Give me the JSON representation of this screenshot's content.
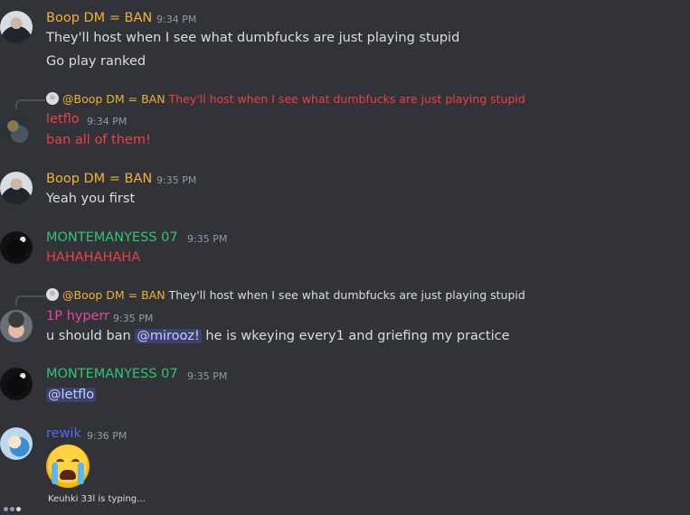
{
  "colors": {
    "boop": "#f0b232",
    "letflo": "#f23f43",
    "monte": "#2dc770",
    "hyperr": "#eb459f",
    "rewik": "#5865f2"
  },
  "messages": [
    {
      "author": "Boop DM = BAN",
      "time": "9:34 PM",
      "lines": [
        "They'll host when I see what dumbfucks are just playing stupid",
        "Go play ranked"
      ]
    },
    {
      "reply": {
        "mention": "@Boop DM = BAN",
        "text": "They'll host when I see what dumbfucks are just playing stupid"
      },
      "author": "letflo",
      "time": "9:34 PM",
      "lines": [
        "ban all of them!"
      ]
    },
    {
      "author": "Boop DM = BAN",
      "time": "9:35 PM",
      "lines": [
        "Yeah you first"
      ]
    },
    {
      "author": "MONTEMANYESS 07",
      "time": "9:35 PM",
      "lines": [
        "HAHAHAHAHA"
      ]
    },
    {
      "reply": {
        "mention": "@Boop DM = BAN",
        "text": "They'll host when I see what dumbfucks are just playing stupid"
      },
      "author": "1P hyperr",
      "time": "9:35 PM",
      "text_before": "u should ban ",
      "mention": "@mirooz!",
      "text_after": "  he is wkeying every1  and griefing my practice"
    },
    {
      "author": "MONTEMANYESS 07",
      "time": "9:35 PM",
      "mention": "@letflo"
    },
    {
      "author": "rewik",
      "time": "9:36 PM",
      "emoji": "loudly-crying-face"
    }
  ],
  "typing": "Keuhki 33l is typing..."
}
